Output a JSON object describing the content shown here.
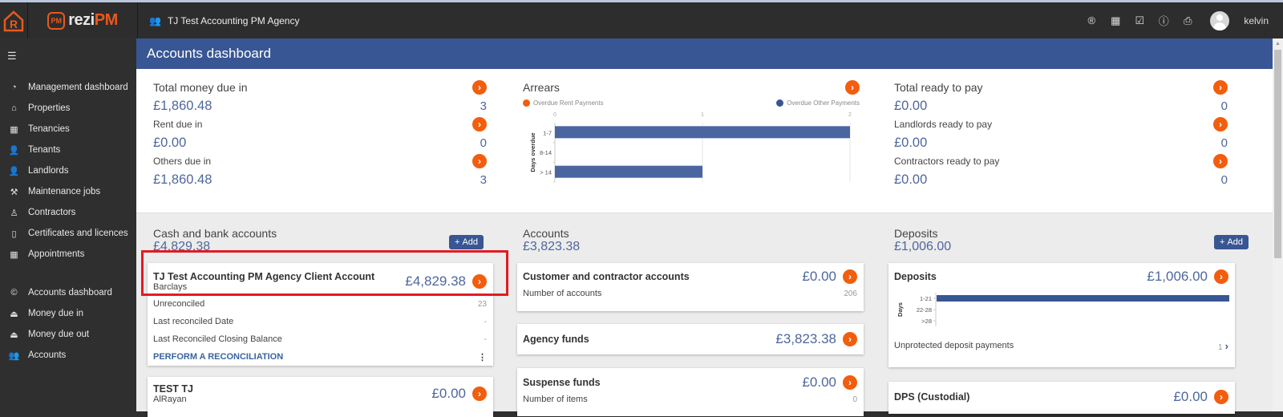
{
  "header": {
    "brand_prefix": "rezi",
    "brand_suffix": "PM",
    "brand_badge": "PM",
    "agency_name": "TJ Test Accounting PM Agency",
    "username": "kelvin",
    "icons": [
      "registered-icon",
      "calendar-icon",
      "checkbox-icon",
      "alert-icon",
      "printer-icon"
    ]
  },
  "sidebar": {
    "items": [
      {
        "label": "Management dashboard",
        "icon": "dashboard-icon",
        "glyph": "◔"
      },
      {
        "label": "Properties",
        "icon": "home-icon",
        "glyph": "⌂"
      },
      {
        "label": "Tenancies",
        "icon": "tenancy-icon",
        "glyph": "▦"
      },
      {
        "label": "Tenants",
        "icon": "user-icon",
        "glyph": "👤"
      },
      {
        "label": "Landlords",
        "icon": "landlord-icon",
        "glyph": "👤"
      },
      {
        "label": "Maintenance jobs",
        "icon": "tools-icon",
        "glyph": "⚒"
      },
      {
        "label": "Contractors",
        "icon": "contractor-icon",
        "glyph": "♙"
      },
      {
        "label": "Certificates and licences",
        "icon": "document-icon",
        "glyph": "▯"
      },
      {
        "label": "Appointments",
        "icon": "calendar-icon",
        "glyph": "▦"
      }
    ],
    "accounts_items": [
      {
        "label": "Accounts dashboard",
        "icon": "euro-circle-icon",
        "glyph": "©"
      },
      {
        "label": "Money due in",
        "icon": "inbox-in-icon",
        "glyph": "⏏"
      },
      {
        "label": "Money due out",
        "icon": "inbox-out-icon",
        "glyph": "⏏"
      },
      {
        "label": "Accounts",
        "icon": "group-icon",
        "glyph": "👥"
      }
    ]
  },
  "page": {
    "title": "Accounts dashboard"
  },
  "summary": {
    "money_in": {
      "total_label": "Total money due in",
      "total_value": "£1,860.48",
      "total_count": "3",
      "rent_label": "Rent due in",
      "rent_value": "£0.00",
      "rent_count": "0",
      "others_label": "Others due in",
      "others_value": "£1,860.48",
      "others_count": "3"
    },
    "arrears": {
      "title": "Arrears",
      "legend_rent": "Overdue Rent Payments",
      "legend_other": "Overdue Other Payments"
    },
    "ready_to_pay": {
      "total_label": "Total ready to pay",
      "total_value": "£0.00",
      "total_count": "0",
      "landlords_label": "Landlords ready to pay",
      "landlords_value": "£0.00",
      "landlords_count": "0",
      "contractors_label": "Contractors ready to pay",
      "contractors_value": "£0.00",
      "contractors_count": "0"
    }
  },
  "chart_data": [
    {
      "type": "bar",
      "orientation": "horizontal",
      "title": "Arrears",
      "categories": [
        "1-7",
        "8-14",
        "> 14"
      ],
      "series": [
        {
          "name": "Overdue Rent Payments",
          "color": "#f25d0e",
          "values": [
            0,
            0,
            0
          ]
        },
        {
          "name": "Overdue Other Payments",
          "color": "#4a65a0",
          "values": [
            2,
            0,
            1
          ]
        }
      ],
      "xlabel": "",
      "ylabel": "Days overdue",
      "xlim": [
        0,
        2
      ],
      "xticks": [
        "0",
        "1",
        "2"
      ],
      "grid": true,
      "legend": "top"
    },
    {
      "type": "bar",
      "orientation": "horizontal",
      "title": "Deposits",
      "categories": [
        "1-21",
        "22-28",
        ">28"
      ],
      "series": [
        {
          "name": "Deposits",
          "color": "#385693",
          "values": [
            1,
            0,
            0
          ]
        }
      ],
      "ylabel": "Days",
      "xlim": [
        0,
        1
      ],
      "grid": false
    }
  ],
  "cash_bank": {
    "title": "Cash and bank accounts",
    "total": "£4,829.38",
    "add_label": "Add",
    "accounts": [
      {
        "name": "TJ Test Accounting PM Agency Client Account",
        "bank": "Barclays",
        "amount": "£4,829.38",
        "unreconciled_label": "Unreconciled",
        "unreconciled_value": "23",
        "last_date_label": "Last reconciled Date",
        "last_date_value": "-",
        "last_balance_label": "Last Reconciled Closing Balance",
        "last_balance_value": "-",
        "action_label": "PERFORM A RECONCILIATION"
      },
      {
        "name": "TEST TJ",
        "bank": "AlRayan",
        "amount": "£0.00"
      }
    ]
  },
  "accounts": {
    "title": "Accounts",
    "total": "£3,823.38",
    "customer": {
      "name": "Customer and contractor accounts",
      "amount": "£0.00",
      "sub_label": "Number of accounts",
      "sub_value": "206"
    },
    "agency": {
      "name": "Agency funds",
      "amount": "£3,823.38"
    },
    "suspense": {
      "name": "Suspense funds",
      "amount": "£0.00",
      "sub_label": "Number of items",
      "sub_value": "0"
    }
  },
  "deposits": {
    "title": "Deposits",
    "total": "£1,006.00",
    "add_label": "Add",
    "card_name": "Deposits",
    "card_amount": "£1,006.00",
    "unprotected_label": "Unprotected deposit payments",
    "unprotected_value": "1",
    "dps": {
      "name": "DPS (Custodial)",
      "amount": "£0.00"
    }
  }
}
